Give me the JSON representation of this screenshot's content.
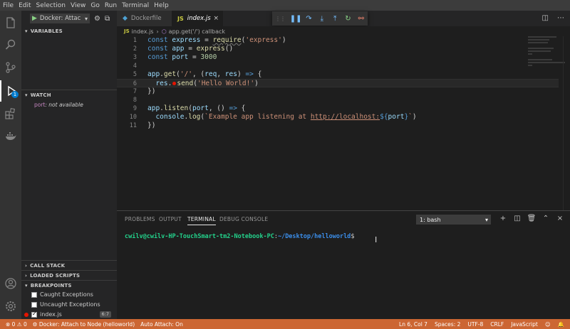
{
  "menu": [
    "File",
    "Edit",
    "Selection",
    "View",
    "Go",
    "Run",
    "Terminal",
    "Help"
  ],
  "debug": {
    "config_label": "Docker: Attac",
    "sections": {
      "variables": "VARIABLES",
      "watch": "WATCH",
      "call_stack": "CALL STACK",
      "loaded_scripts": "LOADED SCRIPTS",
      "breakpoints": "BREAKPOINTS"
    },
    "watch_item": {
      "key": "port",
      "value": "not available"
    },
    "breakpoints": [
      {
        "label": "Caught Exceptions",
        "checked": false
      },
      {
        "label": "Uncaught Exceptions",
        "checked": false
      },
      {
        "label": "index.js",
        "checked": true,
        "count": "6:7"
      }
    ],
    "badge": "1"
  },
  "tabs": [
    {
      "label": "Dockerfile",
      "icon": "docker-icon"
    },
    {
      "label": "index.js",
      "icon": "js-icon",
      "active": true
    }
  ],
  "breadcrumb": {
    "file": "index.js",
    "symbol": "app.get('/') callback"
  },
  "editor": {
    "lines": [
      "1",
      "2",
      "3",
      "4",
      "5",
      "6",
      "7",
      "8",
      "9",
      "10",
      "11"
    ]
  },
  "panel": {
    "tabs": [
      "PROBLEMS",
      "OUTPUT",
      "TERMINAL",
      "DEBUG CONSOLE"
    ],
    "terminal_select": "1: bash",
    "prompt_user": "cwilv@cwilv-HP-TouchSmart-tm2-Notebook-PC",
    "prompt_sep": ":",
    "prompt_path": "~/Desktop/helloworld",
    "prompt_dollar": "$"
  },
  "status": {
    "errors": "0",
    "warnings": "0",
    "debug_target": "Docker: Attach to Node (helloworld)",
    "auto_attach": "Auto Attach: On",
    "position": "Ln 6, Col 7",
    "spaces": "Spaces: 2",
    "encoding": "UTF-8",
    "eol": "CRLF",
    "language": "JavaScript"
  },
  "colors": {
    "status_bar": "#cc6633",
    "accent": "#007acc",
    "breakpoint": "#e51400"
  }
}
